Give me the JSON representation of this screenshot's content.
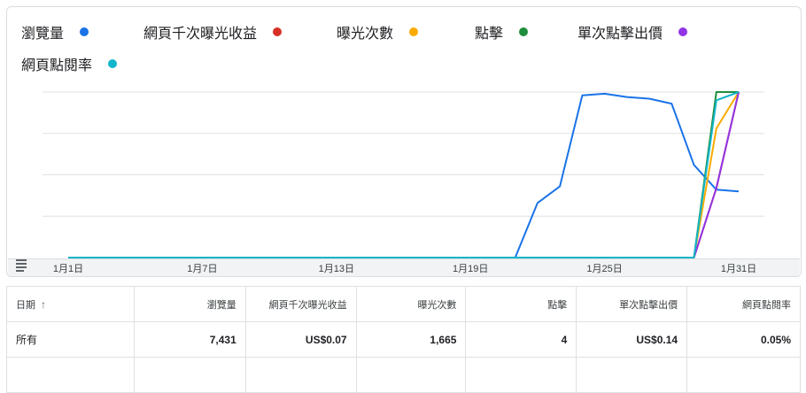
{
  "legend": [
    {
      "label": "瀏覽量",
      "color": "#1a73e8"
    },
    {
      "label": "網頁千次曝光收益",
      "color": "#d93025"
    },
    {
      "label": "曝光次數",
      "color": "#f9ab00"
    },
    {
      "label": "點擊",
      "color": "#1e8e3e"
    },
    {
      "label": "單次點擊出價",
      "color": "#9334e6"
    },
    {
      "label": "網頁點閱率",
      "color": "#12b5cb"
    }
  ],
  "chart_data": {
    "type": "line",
    "x_tick_labels": [
      "1月1日",
      "1月7日",
      "1月13日",
      "1月19日",
      "1月25日",
      "1月31日"
    ],
    "x": [
      1,
      2,
      3,
      4,
      5,
      6,
      7,
      8,
      9,
      10,
      11,
      12,
      13,
      14,
      15,
      16,
      17,
      18,
      19,
      20,
      21,
      22,
      23,
      24,
      25,
      26,
      27,
      28,
      29,
      30,
      31
    ],
    "ylim": [
      0,
      1
    ],
    "grid": true,
    "series": [
      {
        "name": "瀏覽量",
        "color": "#1a73e8",
        "values": [
          0,
          0,
          0,
          0,
          0,
          0,
          0,
          0,
          0,
          0,
          0,
          0,
          0,
          0,
          0,
          0,
          0,
          0,
          0,
          0,
          0,
          0.33,
          0.43,
          0.98,
          0.99,
          0.97,
          0.96,
          0.93,
          0.56,
          0.41,
          0.4
        ]
      },
      {
        "name": "網頁千次曝光收益",
        "color": "#d93025",
        "values": [
          0,
          0,
          0,
          0,
          0,
          0,
          0,
          0,
          0,
          0,
          0,
          0,
          0,
          0,
          0,
          0,
          0,
          0,
          0,
          0,
          0,
          0,
          0,
          0,
          0,
          0,
          0,
          0,
          0,
          0.42,
          1.0
        ]
      },
      {
        "name": "曝光次數",
        "color": "#f9ab00",
        "values": [
          0,
          0,
          0,
          0,
          0,
          0,
          0,
          0,
          0,
          0,
          0,
          0,
          0,
          0,
          0,
          0,
          0,
          0,
          0,
          0,
          0,
          0,
          0,
          0,
          0,
          0,
          0,
          0,
          0,
          0.78,
          1.0
        ]
      },
      {
        "name": "點擊",
        "color": "#1e8e3e",
        "values": [
          0,
          0,
          0,
          0,
          0,
          0,
          0,
          0,
          0,
          0,
          0,
          0,
          0,
          0,
          0,
          0,
          0,
          0,
          0,
          0,
          0,
          0,
          0,
          0,
          0,
          0,
          0,
          0,
          0,
          1.0,
          1.0
        ]
      },
      {
        "name": "單次點擊出價",
        "color": "#9334e6",
        "values": [
          0,
          0,
          0,
          0,
          0,
          0,
          0,
          0,
          0,
          0,
          0,
          0,
          0,
          0,
          0,
          0,
          0,
          0,
          0,
          0,
          0,
          0,
          0,
          0,
          0,
          0,
          0,
          0,
          0,
          0.42,
          1.0
        ]
      },
      {
        "name": "網頁點閱率",
        "color": "#12b5cb",
        "values": [
          0,
          0,
          0,
          0,
          0,
          0,
          0,
          0,
          0,
          0,
          0,
          0,
          0,
          0,
          0,
          0,
          0,
          0,
          0,
          0,
          0,
          0,
          0,
          0,
          0,
          0,
          0,
          0,
          0,
          0.95,
          1.0
        ]
      }
    ]
  },
  "table": {
    "headers": [
      "日期",
      "瀏覽量",
      "網頁千次曝光收益",
      "曝光次數",
      "點擊",
      "單次點擊出價",
      "網頁點閱率"
    ],
    "sort_arrow": "↑",
    "rows": [
      [
        "所有",
        "7,431",
        "US$0.07",
        "1,665",
        "4",
        "US$0.14",
        "0.05%"
      ]
    ]
  }
}
